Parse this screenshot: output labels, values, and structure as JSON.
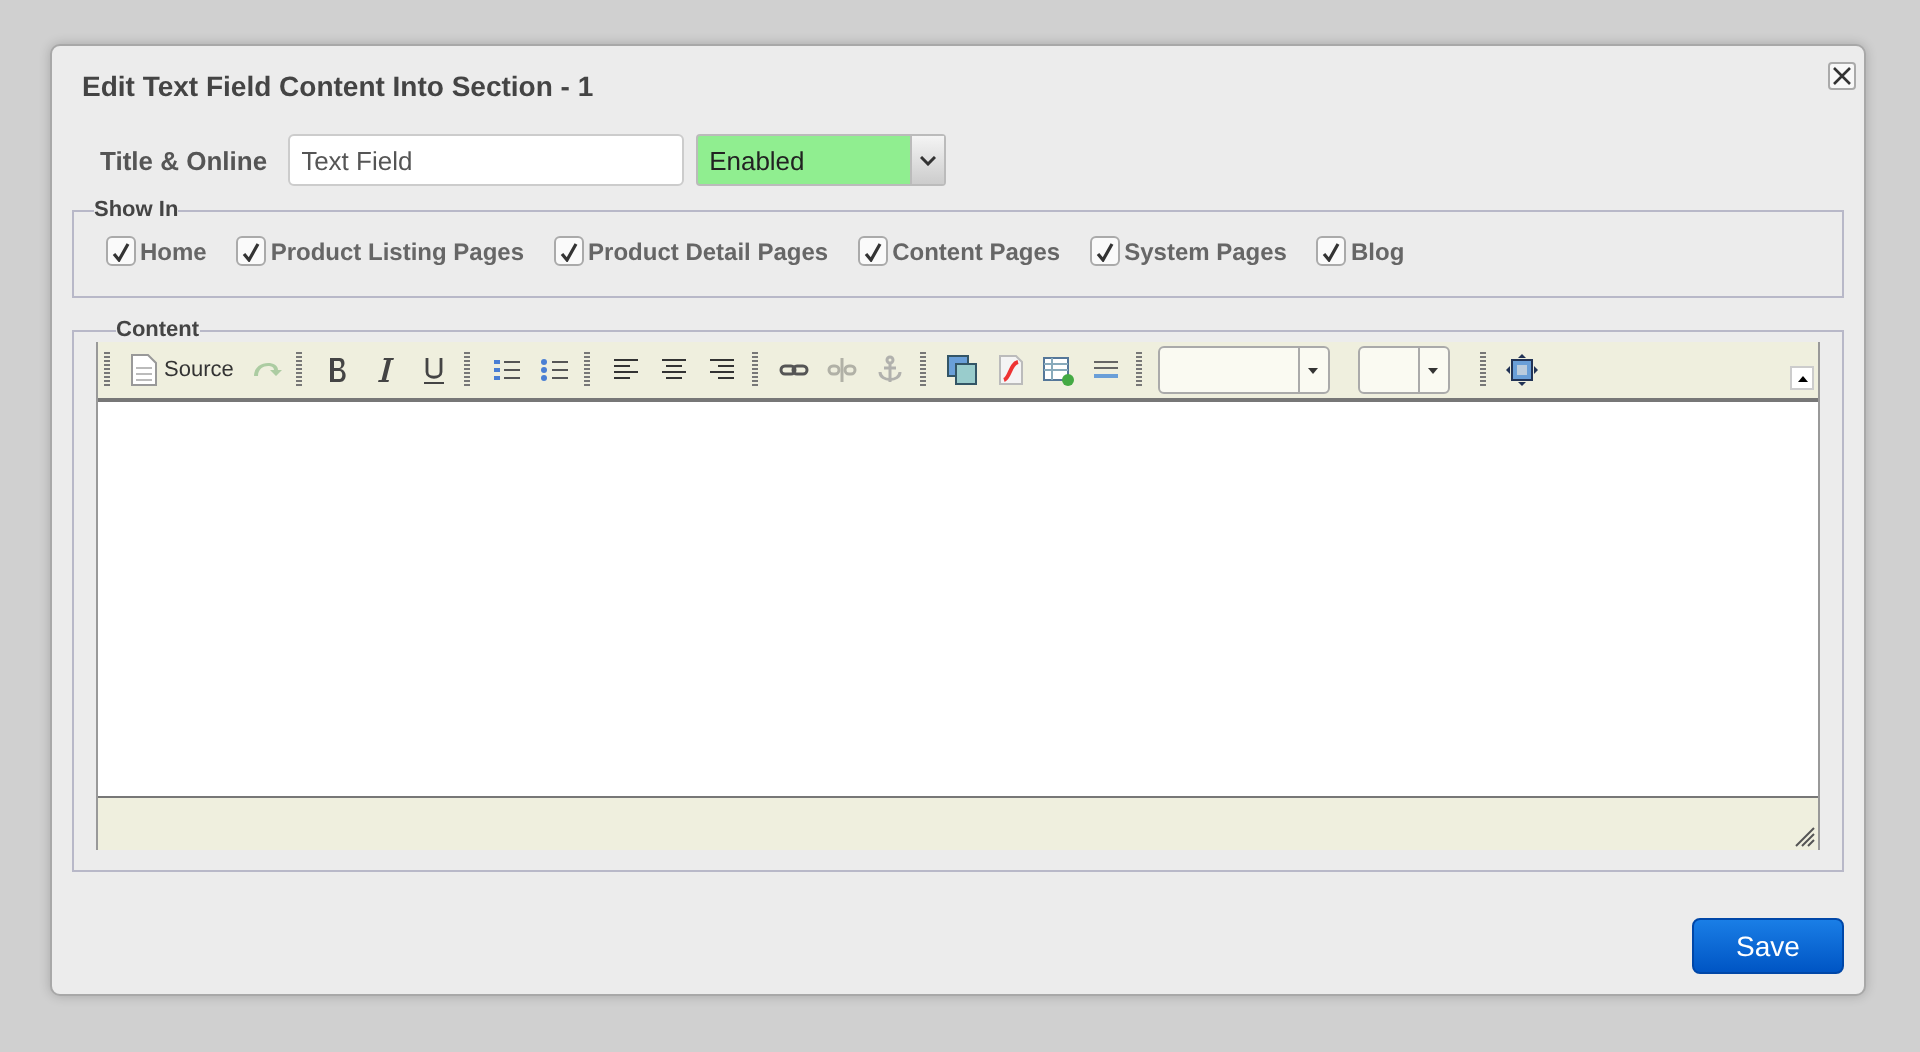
{
  "dialog": {
    "title": "Edit Text Field Content Into Section - 1",
    "title_row": {
      "label": "Title & Online",
      "input_value": "Text Field",
      "status_value": "Enabled"
    },
    "show_in": {
      "legend": "Show In",
      "options": [
        {
          "label": "Home",
          "checked": true
        },
        {
          "label": "Product Listing Pages",
          "checked": true
        },
        {
          "label": "Product Detail Pages",
          "checked": true
        },
        {
          "label": "Content Pages",
          "checked": true
        },
        {
          "label": "System Pages",
          "checked": true
        },
        {
          "label": "Blog",
          "checked": true
        }
      ]
    },
    "content": {
      "legend": "Content",
      "toolbar": [
        [
          {
            "kind": "source",
            "label": "Source",
            "disabled": false
          },
          {
            "kind": "redo",
            "disabled": true
          }
        ],
        [
          {
            "kind": "bold",
            "disabled": false
          },
          {
            "kind": "italic",
            "disabled": false
          },
          {
            "kind": "underline",
            "disabled": false
          }
        ],
        [
          {
            "kind": "ordered-list",
            "disabled": false
          },
          {
            "kind": "bullet-list",
            "disabled": false
          }
        ],
        [
          {
            "kind": "align-left",
            "disabled": false
          },
          {
            "kind": "align-center",
            "disabled": false
          },
          {
            "kind": "align-right",
            "disabled": false
          }
        ],
        [
          {
            "kind": "link",
            "disabled": false
          },
          {
            "kind": "unlink",
            "disabled": true
          },
          {
            "kind": "anchor",
            "disabled": true
          }
        ],
        [
          {
            "kind": "image",
            "disabled": false
          },
          {
            "kind": "flash",
            "disabled": false
          },
          {
            "kind": "table",
            "disabled": false
          },
          {
            "kind": "rule",
            "disabled": false
          }
        ],
        [
          {
            "kind": "combo-wide",
            "disabled": false
          },
          {
            "kind": "combo-narrow",
            "disabled": false
          }
        ],
        [
          {
            "kind": "maximize",
            "disabled": false
          }
        ]
      ]
    },
    "save_button": "Save"
  }
}
